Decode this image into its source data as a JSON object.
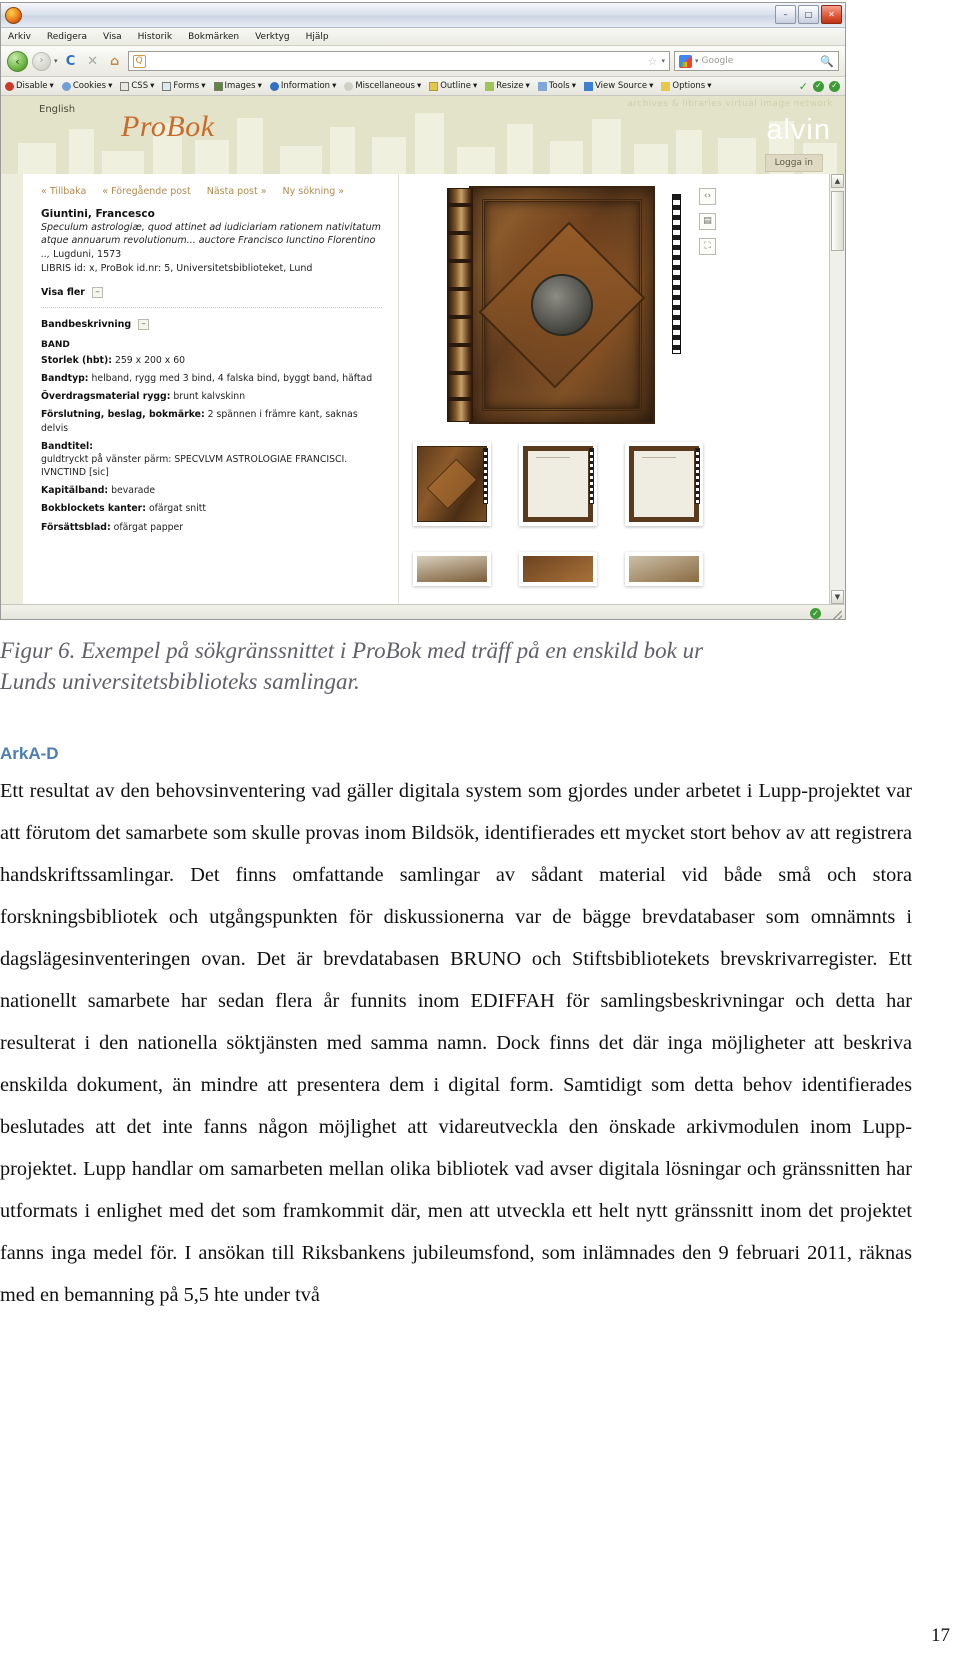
{
  "browser": {
    "menu_items": [
      "Arkiv",
      "Redigera",
      "Visa",
      "Historik",
      "Bokmärken",
      "Verktyg",
      "Hjälp"
    ],
    "window_buttons": {
      "minimize": "–",
      "maximize": "□",
      "close": "✕"
    },
    "nav": {
      "back": "‹",
      "forward": "›",
      "reload": "C",
      "stop": "✕",
      "home": "⌂",
      "dropdown_caret": "▾"
    },
    "url_value": "",
    "url_favicon": "Q",
    "star": "☆",
    "search_placeholder": "Google",
    "search_go": "🔍",
    "devtoolbar": [
      "Disable",
      "Cookies",
      "CSS",
      "Forms",
      "Images",
      "Information",
      "Miscellaneous",
      "Outline",
      "Resize",
      "Tools",
      "View Source",
      "Options"
    ],
    "devtoolbar_suffix": "▾",
    "status_ok": "✓"
  },
  "site": {
    "tagline": "archives & libraries virtual image network",
    "brand_right": "alvin",
    "language_link": "English",
    "logo": "ProBok",
    "login_button": "Logga in"
  },
  "record": {
    "nav_links": [
      "« Tillbaka",
      "« Föregående post",
      "Nästa post »",
      "Ny sökning »"
    ],
    "author": "Giuntini, Francesco",
    "title_italic": "Speculum astrologiæ, quod attinet ad iudiciariam rationem nativitatum atque annuarum revolutionum... auctore Francisco Iunctino Florentino ..,",
    "title_plain": "Lugduni, 1573",
    "ids": "LIBRIS id: x, ProBok id.nr: 5, Universitetsbiblioteket, Lund",
    "show_more_label": "Visa fler",
    "toggle_glyph": "–",
    "section_title": "Bandbeskrivning",
    "band_label": "BAND",
    "fields": [
      {
        "label": "Storlek (hbt):",
        "value": "259 x 200 x 60"
      },
      {
        "label": "Bandtyp:",
        "value": "helband, rygg med 3 bind, 4 falska bind, byggt band, häftad"
      },
      {
        "label": "Överdragsmaterial rygg:",
        "value": "brunt kalvskinn"
      },
      {
        "label": "Förslutning, beslag, bokmärke:",
        "value": "2 spännen i främre kant, saknas delvis"
      },
      {
        "label": "Bandtitel:",
        "value": "guldtryckt på vänster pärm: SPECVLVM ASTROLOGIAE FRANCISCI. IVNCTIND [sic]"
      },
      {
        "label": "Kapitälband:",
        "value": "bevarade"
      },
      {
        "label": "Bokblockets kanter:",
        "value": "ofärgat snitt"
      },
      {
        "label": "Försättsblad:",
        "value": "ofärgat papper"
      }
    ],
    "viewer_tools": [
      "‹›",
      "▤",
      "⛶"
    ],
    "scrollbar": {
      "up": "▲",
      "down": "▼"
    }
  },
  "document": {
    "caption_line1": "Figur 6. Exempel på sökgränssnittet i ProBok med träff på en enskild bok ur",
    "caption_line2": "Lunds universitetsbiblioteks samlingar.",
    "heading": "ArkA-D",
    "body": "Ett resultat av den behovsinventering vad gäller digitala system som gjordes under arbetet i Lupp-projektet var att förutom det samarbete som skulle provas inom Bildsök, identifierades ett mycket stort behov av att registrera handskriftssamlingar. Det finns omfattande samlingar av sådant material vid både små och stora forskningsbibliotek och utgångspunkten för diskussionerna var de bägge brevdatabaser som omnämnts i dagslägesinventeringen ovan. Det är brevdatabasen BRUNO och Stiftsbibliotekets brevskrivarregister. Ett nationellt samarbete har sedan flera år funnits inom EDIFFAH för samlingsbeskrivningar och detta har resulterat i den nationella söktjänsten med samma namn. Dock finns det där inga möjligheter att beskriva enskilda dokument, än mindre att presentera dem i digital form. Samtidigt som detta behov identifierades beslutades att det inte fanns någon möjlighet att vidareutveckla den önskade arkivmodulen inom Lupp-projektet. Lupp handlar om samarbeten mellan olika bibliotek vad avser digitala lösningar och gränssnitten har utformats i enlighet med det som framkommit där, men att utveckla ett helt nytt gränssnitt inom det projektet fanns inga medel för. I ansökan till Riksbankens jubileumsfond, som inlämnades den 9 februari 2011, räknas med en bemanning på 5,5 hte under två",
    "page_number": "17"
  },
  "colors": {
    "heading_blue": "#4d7db5",
    "caption_gray": "#5f6068",
    "header_band": "#e2e3c8",
    "probok_orange": "#c96a2b",
    "link_gold": "#b08a4e"
  }
}
